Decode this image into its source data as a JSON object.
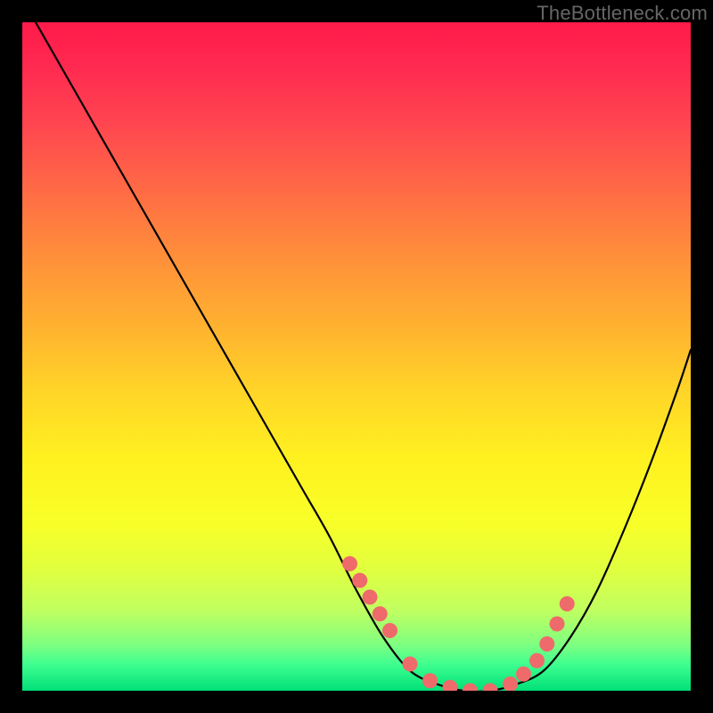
{
  "watermark": "TheBottleneck.com",
  "chart_data": {
    "type": "line",
    "title": "",
    "xlabel": "",
    "ylabel": "",
    "xlim": [
      0,
      100
    ],
    "ylim": [
      0,
      100
    ],
    "series": [
      {
        "name": "bottleneck-curve",
        "x": [
          2,
          6,
          10,
          14,
          18,
          22,
          26,
          30,
          34,
          38,
          42,
          46,
          50,
          54,
          58,
          62,
          66,
          70,
          74,
          78,
          82,
          86,
          90,
          94,
          98,
          100
        ],
        "y": [
          100,
          93,
          86,
          79,
          72,
          65,
          58,
          51,
          44,
          37,
          30,
          23,
          15,
          8,
          3,
          1,
          0,
          0,
          1,
          3,
          8,
          15,
          24,
          34,
          45,
          51
        ]
      }
    ],
    "markers": {
      "name": "highlight-dots",
      "x": [
        49,
        50.5,
        52,
        53.5,
        55,
        58,
        61,
        64,
        67,
        70,
        73,
        75,
        77,
        78.5,
        80,
        81.5
      ],
      "y": [
        19,
        16.5,
        14,
        11.5,
        9,
        4,
        1.5,
        0.5,
        0,
        0,
        1,
        2.5,
        4.5,
        7,
        10,
        13
      ]
    },
    "background_gradient": {
      "top": "#ff1a4a",
      "mid": "#fff020",
      "bottom": "#00e078"
    }
  }
}
